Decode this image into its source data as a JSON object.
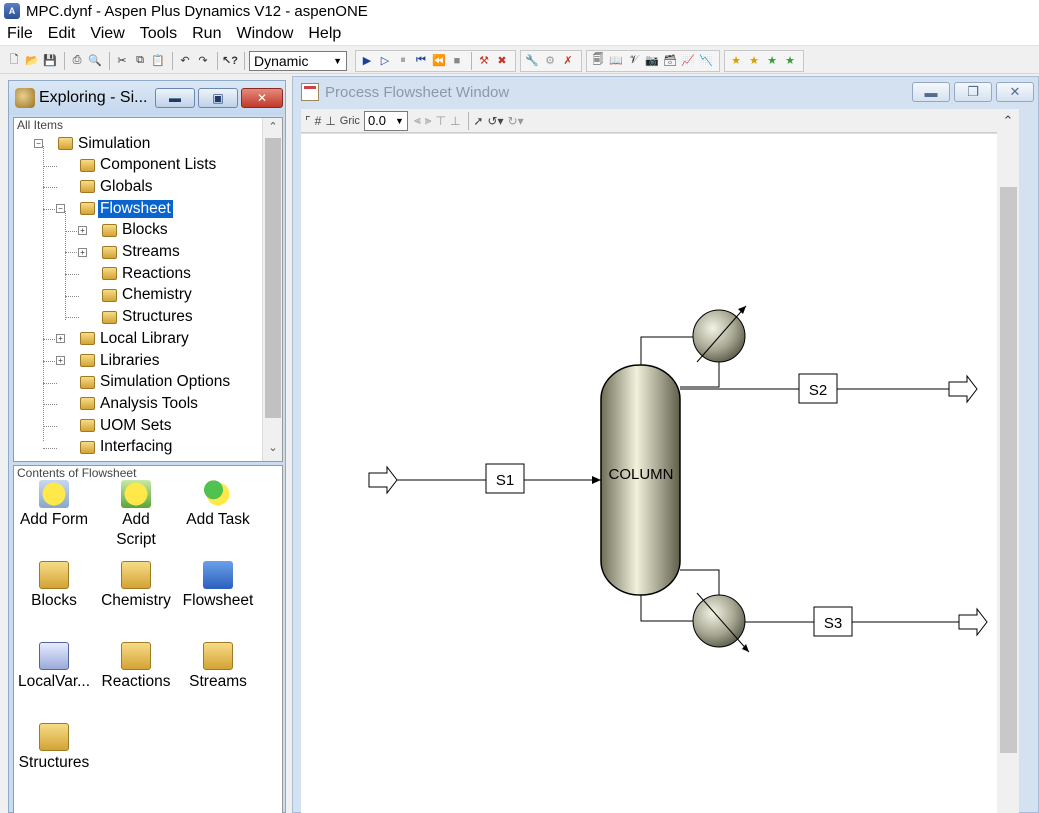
{
  "window": {
    "title": "MPC.dynf - Aspen Plus Dynamics V12 - aspenONE",
    "app_icon": "aspen-app-icon"
  },
  "menu": [
    "File",
    "Edit",
    "View",
    "Tools",
    "Run",
    "Window",
    "Help"
  ],
  "toolbar": {
    "run_mode": "Dynamic"
  },
  "explorer": {
    "title": "Exploring - Si...",
    "tree_caption": "All Items",
    "tree": [
      {
        "label": "Simulation",
        "expander": "⊟"
      },
      {
        "label": "Component Lists"
      },
      {
        "label": "Globals"
      },
      {
        "label": "Flowsheet",
        "expander": "⊟",
        "selected": true
      },
      {
        "label": "Blocks",
        "expander": "⊞"
      },
      {
        "label": "Streams",
        "expander": "⊞"
      },
      {
        "label": "Reactions"
      },
      {
        "label": "Chemistry"
      },
      {
        "label": "Structures"
      },
      {
        "label": "Local Library",
        "expander": "⊞"
      },
      {
        "label": "Libraries",
        "expander": "⊞"
      },
      {
        "label": "Simulation Options"
      },
      {
        "label": "Analysis Tools"
      },
      {
        "label": "UOM Sets"
      },
      {
        "label": "Interfacing"
      }
    ],
    "contents_caption": "Contents of Flowsheet",
    "contents": [
      {
        "label": "Add Form",
        "icon": "add-form-icon"
      },
      {
        "label": "Add Script",
        "icon": "add-script-icon"
      },
      {
        "label": "Add Task",
        "icon": "add-task-icon"
      },
      {
        "label": "Blocks",
        "icon": "blocks-folder-icon"
      },
      {
        "label": "Chemistry",
        "icon": "chemistry-folder-icon"
      },
      {
        "label": "Flowsheet",
        "icon": "flowsheet-icon"
      },
      {
        "label": "LocalVar...",
        "icon": "local-variables-icon"
      },
      {
        "label": "Reactions",
        "icon": "reactions-folder-icon"
      },
      {
        "label": "Streams",
        "icon": "streams-folder-icon"
      },
      {
        "label": "Structures",
        "icon": "structures-folder-icon"
      }
    ]
  },
  "flowsheet": {
    "title": "Process Flowsheet Window",
    "grid_label": "Gric",
    "grid_value": "0.0",
    "column_label": "COLUMN",
    "streams": {
      "s1": "S1",
      "s2": "S2",
      "s3": "S3"
    }
  }
}
